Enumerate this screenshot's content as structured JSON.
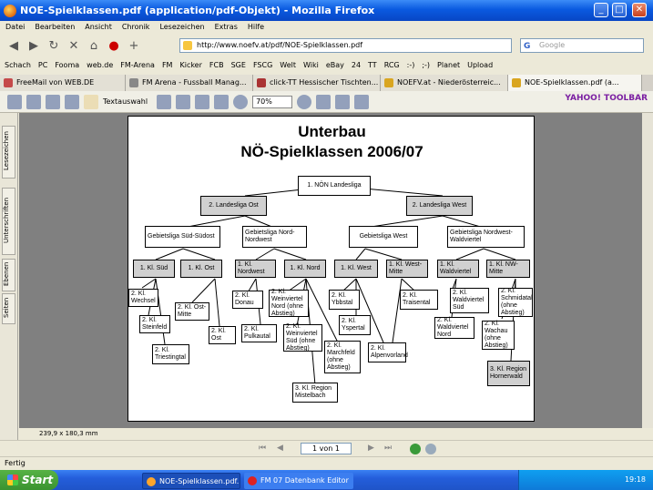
{
  "window": {
    "title": "NOE-Spielklassen.pdf (application/pdf-Objekt) - Mozilla Firefox"
  },
  "menu": [
    "Datei",
    "Bearbeiten",
    "Ansicht",
    "Chronik",
    "Lesezeichen",
    "Extras",
    "Hilfe"
  ],
  "nav": {
    "url": "http://www.noefv.at/pdf/NOE-Spielklassen.pdf",
    "search_placeholder": "Google"
  },
  "bookmarks": [
    "Schach",
    "PC",
    "Fooma",
    "web.de",
    "FM-Arena",
    "FM",
    "Kicker",
    "FCB",
    "SGE",
    "FSCG",
    "Welt",
    "Wiki",
    "eBay",
    "24",
    "TT",
    "RCG",
    ":-)",
    ";-)",
    "Planet",
    "Upload"
  ],
  "tabs": [
    "FreeMail von WEB.DE",
    "FM Arena - Fussball Manag...",
    "click-TT Hessischer Tischten...",
    "NOEFV.at - Niederösterreic...",
    "NOE-Spielklassen.pdf (a..."
  ],
  "pdf_toolbar": {
    "select_label": "Textauswahl",
    "zoom": "70%",
    "yahoo": "YAHOO! TOOLBAR"
  },
  "sidebar_tabs": [
    "Lesezeichen",
    "Unterschriften",
    "Ebenen",
    "Seiten"
  ],
  "document": {
    "title": "Unterbau",
    "subtitle": "NÖ-Spielklassen 2006/07",
    "nodes": {
      "root": "1. NÖN Landesliga",
      "lo": "2. Landesliga Ost",
      "lw": "2. Landesliga West",
      "gso": "Gebietsliga Süd-Südost",
      "gno": "Gebietsliga Nord-Nordwest",
      "gw": "Gebietsliga West",
      "gnw": "Gebietsliga Nordwest-Waldviertel",
      "k_sued": "1. Kl. Süd",
      "k_ost": "1. Kl. Ost",
      "k_nw": "1. Kl. Nordwest",
      "k_nord": "1. Kl. Nord",
      "k_west": "1. Kl. West",
      "k_wm": "1. Kl. West-Mitte",
      "k_wv": "1. Kl. Waldviertel",
      "k_nwm": "1. Kl. NW-Mitte",
      "wechsel": "2. Kl. Wechsel",
      "steinfeld": "2. Kl. Steinfeld",
      "triestingtal": "2. Kl. Triestingtal",
      "ostmitte": "2. Kl. Ost-Mitte",
      "ost2": "2. Kl. Ost",
      "donau": "2. Kl. Donau",
      "pulkautal": "2. Kl. Pulkautal",
      "wvnord": "2. Kl. Weinviertel Nord (ohne Abstieg)",
      "wvsued": "2. Kl. Weinviertel Süd (ohne Abstieg)",
      "marchfeld": "2. Kl. Marchfeld (ohne Abstieg)",
      "mistelbach": "3. Kl. Region Mistelbach",
      "ybbstal": "2. Kl. Ybbstal",
      "ybbsgap": "2. Kl. Yspertal",
      "traisental": "2. Kl. Traisental",
      "alpenvorland": "2. Kl. Alpenvorland",
      "wvsued2": "2. Kl. Waldviertel Süd",
      "wvnord2": "2. Kl. Waldviertel Nord",
      "schmidatal": "2. Kl. Schmidatal (ohne Abstieg)",
      "wachau": "2. Kl. Wachau (ohne Abstieg)",
      "horner": "3. Kl. Region Hornerwald"
    }
  },
  "size_label": "239,9 x 180,3 mm",
  "pager": {
    "value": "1 von 1"
  },
  "status": "Fertig",
  "taskbar": {
    "start": "Start",
    "items": [
      "NOE-Spielklassen.pdf...",
      "FM 07 Datenbank Editor"
    ],
    "clock": "19:18"
  }
}
